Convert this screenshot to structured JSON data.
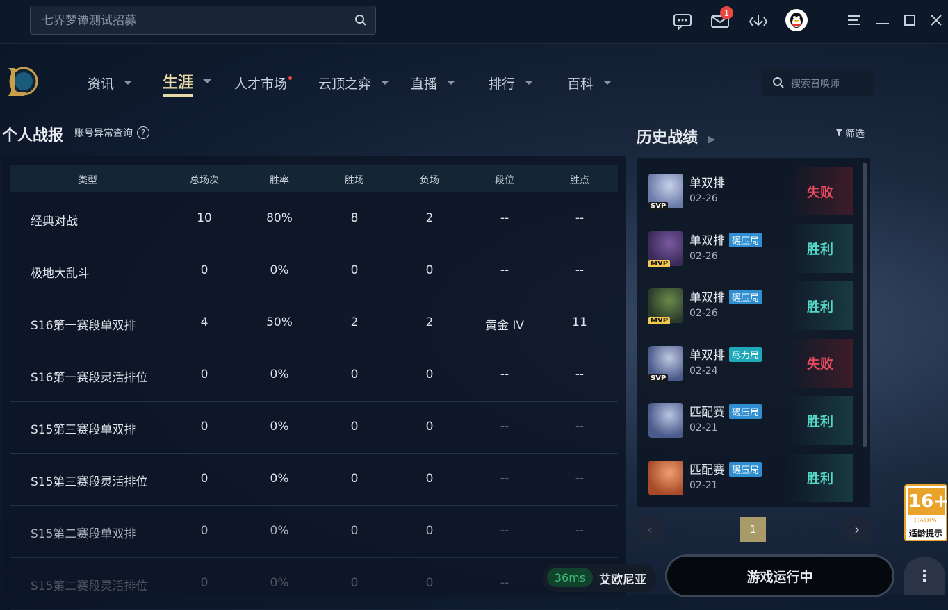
{
  "search": {
    "placeholder": "七界梦谭测试招募"
  },
  "topbar": {
    "mail_badge": "1"
  },
  "nav": {
    "items": [
      {
        "label": "资讯"
      },
      {
        "label": "生涯"
      },
      {
        "label": "人才市场"
      },
      {
        "label": "云顶之弈"
      },
      {
        "label": "直播"
      },
      {
        "label": "排行"
      },
      {
        "label": "百科"
      }
    ],
    "summoner_search_placeholder": "搜索召唤师"
  },
  "stats": {
    "title": "个人战报",
    "anomaly_link": "账号异常查询",
    "anomaly_icon": "?",
    "headers": [
      "类型",
      "总场次",
      "胜率",
      "胜场",
      "负场",
      "段位",
      "胜点"
    ],
    "rows": [
      [
        "经典对战",
        "10",
        "80%",
        "8",
        "2",
        "--",
        "--"
      ],
      [
        "极地大乱斗",
        "0",
        "0%",
        "0",
        "0",
        "--",
        "--"
      ],
      [
        "S16第一赛段单双排",
        "4",
        "50%",
        "2",
        "2",
        "黄金 IV",
        "11"
      ],
      [
        "S16第一赛段灵活排位",
        "0",
        "0%",
        "0",
        "0",
        "--",
        "--"
      ],
      [
        "S15第三赛段单双排",
        "0",
        "0%",
        "0",
        "0",
        "--",
        "--"
      ],
      [
        "S15第三赛段灵活排位",
        "0",
        "0%",
        "0",
        "0",
        "--",
        "--"
      ],
      [
        "S15第二赛段单双排",
        "0",
        "0%",
        "0",
        "0",
        "--",
        "--"
      ],
      [
        "S15第二赛段灵活排位",
        "0",
        "0%",
        "0",
        "0",
        "--",
        "--"
      ]
    ]
  },
  "history": {
    "title": "历史战绩",
    "filter_label": "筛选",
    "matches": [
      {
        "mode": "单双排",
        "tag": "",
        "date": "02-26",
        "result": "失败",
        "badge": "SVP",
        "outcome": "lose"
      },
      {
        "mode": "单双排",
        "tag": "碾压局",
        "date": "02-26",
        "result": "胜利",
        "badge": "MVP",
        "outcome": "win"
      },
      {
        "mode": "单双排",
        "tag": "碾压局",
        "date": "02-26",
        "result": "胜利",
        "badge": "MVP",
        "outcome": "win"
      },
      {
        "mode": "单双排",
        "tag": "尽力局",
        "date": "02-24",
        "result": "失败",
        "badge": "SVP",
        "outcome": "lose"
      },
      {
        "mode": "匹配赛",
        "tag": "碾压局",
        "date": "02-21",
        "result": "胜利",
        "badge": "",
        "outcome": "win"
      },
      {
        "mode": "匹配赛",
        "tag": "碾压局",
        "date": "02-21",
        "result": "胜利",
        "badge": "",
        "outcome": "win"
      }
    ],
    "page": "1"
  },
  "age_rating": {
    "number": "16+",
    "org": "CADPA",
    "label": "适龄提示"
  },
  "bottom": {
    "ping": "36ms",
    "server": "艾欧尼亚",
    "game_button": "游戏运行中",
    "more": "⋮"
  },
  "colors": {
    "accent_gold": "#e8d7a7",
    "win": "#55d6c6",
    "lose": "#e84a5f",
    "tag_blue": "#2f8fd1",
    "ping_green": "#3fb876"
  }
}
